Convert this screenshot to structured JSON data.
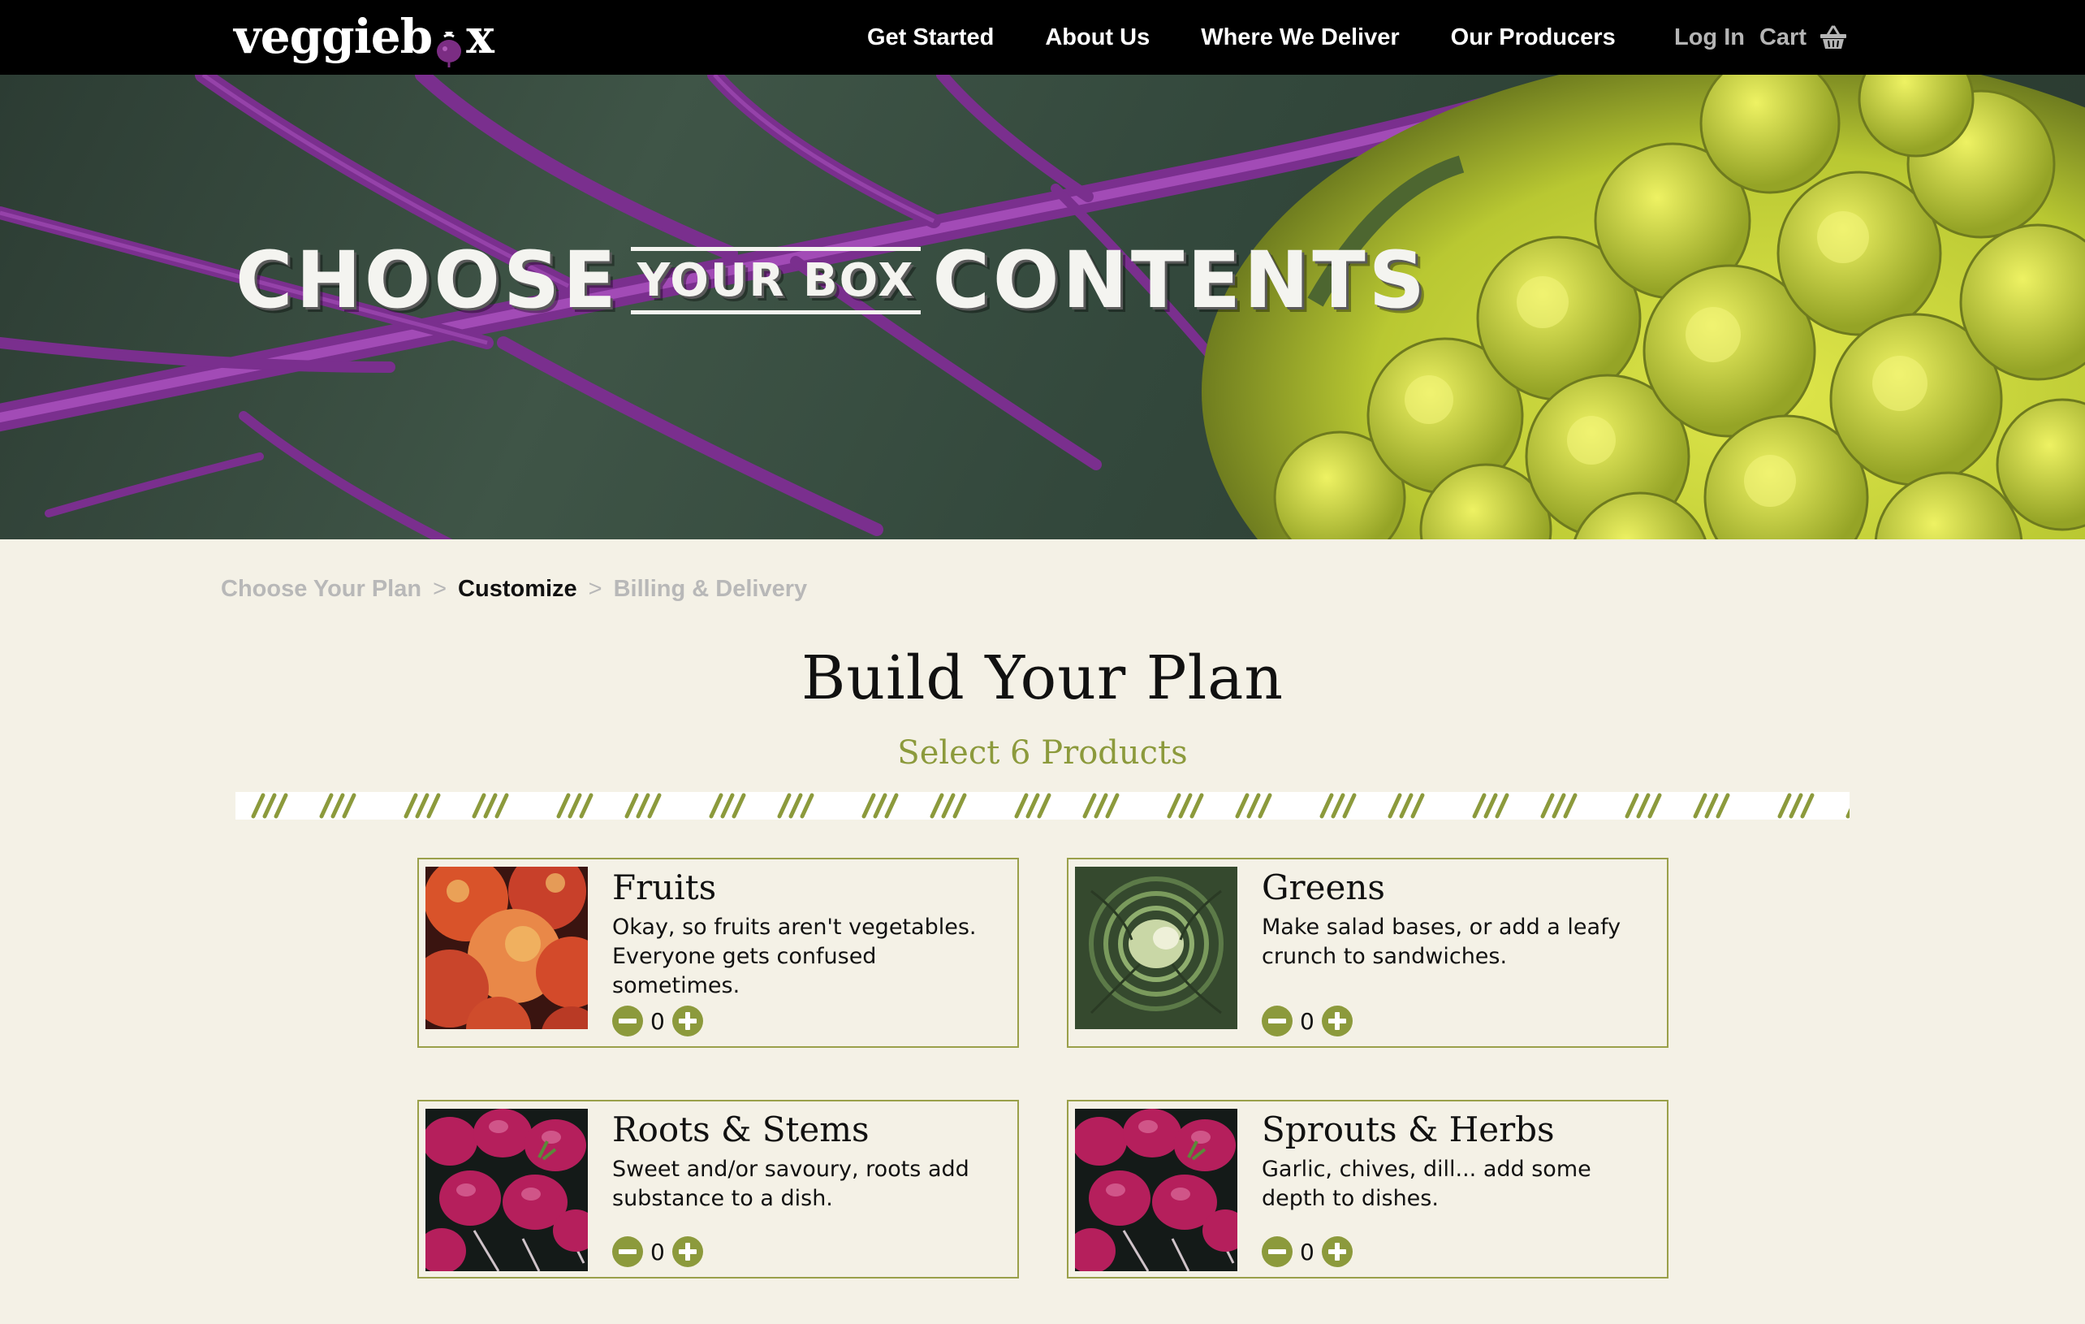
{
  "nav": {
    "logo": "veggiebox",
    "links": [
      "Get Started",
      "About Us",
      "Where We Deliver",
      "Our Producers"
    ],
    "login": "Log In",
    "cart": "Cart"
  },
  "hero": {
    "word1": "CHOOSE",
    "middle": "YOUR BOX",
    "word2": "CONTENTS"
  },
  "breadcrumb": {
    "steps": [
      "Choose Your Plan",
      "Customize",
      "Billing & Delivery"
    ],
    "separator": ">",
    "active_index": 1
  },
  "page": {
    "title": "Build Your Plan",
    "subtitle": "Select 6 Products"
  },
  "products": [
    {
      "name": "Fruits",
      "description": "Okay, so fruits aren't vegetables. Everyone gets confused sometimes.",
      "quantity": "0",
      "image": "peaches-photo"
    },
    {
      "name": "Greens",
      "description": "Make salad bases, or add a leafy crunch to sandwiches.",
      "quantity": "0",
      "image": "lettuce-photo"
    },
    {
      "name": "Roots & Stems",
      "description": "Sweet and/or savoury, roots add substance to a dish.",
      "quantity": "0",
      "image": "radishes-photo"
    },
    {
      "name": "Sprouts & Herbs",
      "description": "Garlic, chives, dill... add some depth to dishes.",
      "quantity": "0",
      "image": "radishes-photo"
    }
  ],
  "colors": {
    "accent": "#8c9a3c",
    "card_border": "#9aa04a",
    "background": "#f4f1e6",
    "nav_bg": "#000000"
  }
}
